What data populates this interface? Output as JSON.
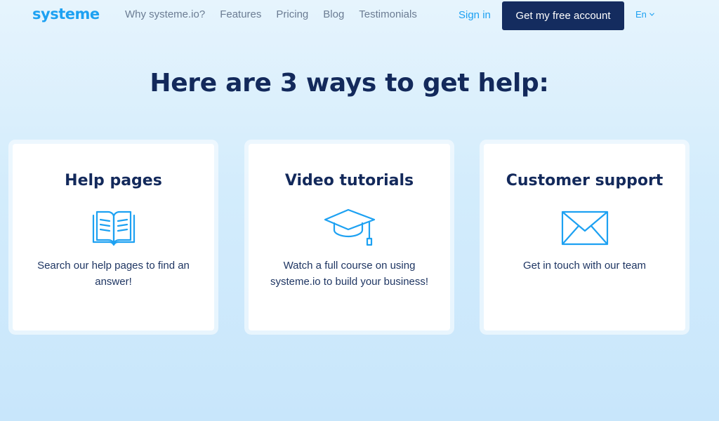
{
  "nav": {
    "logo": "systeme",
    "links": [
      "Why systeme.io?",
      "Features",
      "Pricing",
      "Blog",
      "Testimonials"
    ],
    "sign_in": "Sign in",
    "cta": "Get my free account",
    "language": "En",
    "language_chevron": "chevron-down-icon"
  },
  "headline": "Here are 3 ways to get help:",
  "cards": [
    {
      "title": "Help pages",
      "icon": "open-book-icon",
      "text": "Search our help pages to find an answer!"
    },
    {
      "title": "Video tutorials",
      "icon": "graduation-cap-icon",
      "text": "Watch a full course on using systeme.io to build your business!"
    },
    {
      "title": "Customer support",
      "icon": "envelope-icon",
      "text": "Get in touch with our team"
    }
  ],
  "colors": {
    "brand_blue": "#1da1f2",
    "navy": "#13295b",
    "cta_bg": "#142c5f",
    "nav_text": "#6b7c93"
  }
}
